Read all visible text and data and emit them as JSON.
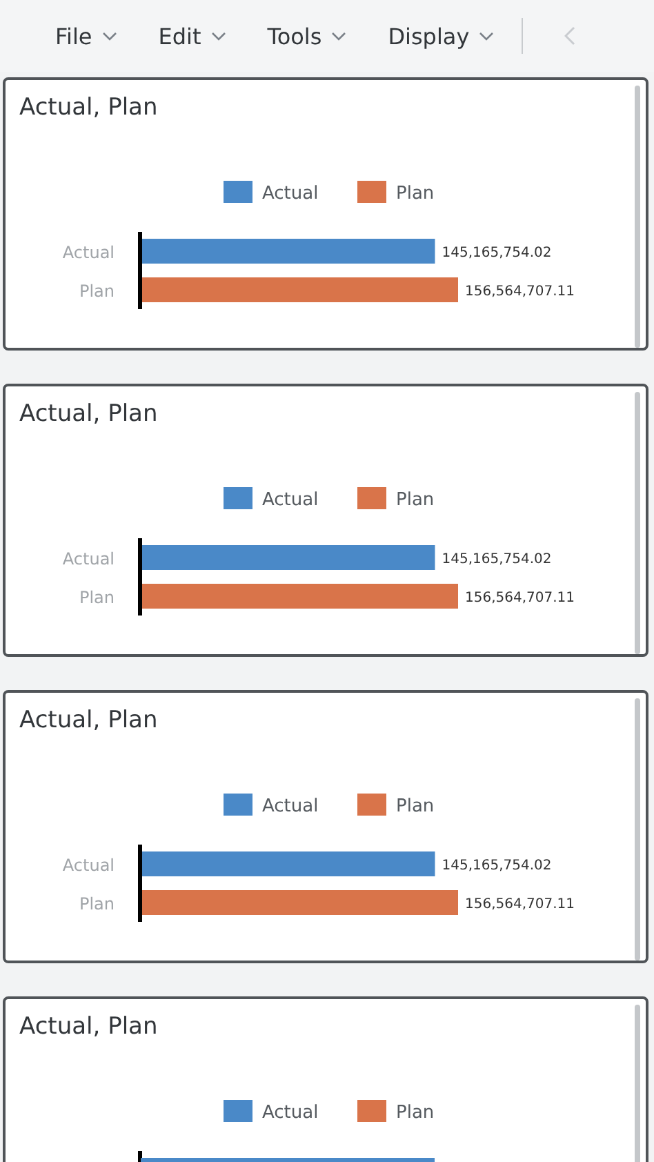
{
  "menu": [
    {
      "label": "File"
    },
    {
      "label": "Edit"
    },
    {
      "label": "Tools"
    },
    {
      "label": "Display"
    }
  ],
  "cards": [
    {
      "title": "Actual, Plan",
      "chart_data": {
        "type": "bar",
        "orientation": "horizontal",
        "legend": "top",
        "categories": [
          "Actual",
          "Plan"
        ],
        "series": [
          {
            "name": "Actual",
            "color": "#4a89c8",
            "values": [
              145165754.02,
              null
            ],
            "value_labels": [
              "145,165,754.02",
              null
            ]
          },
          {
            "name": "Plan",
            "color": "#d9744a",
            "values": [
              null,
              156564707.11
            ],
            "value_labels": [
              null,
              "156,564,707.11"
            ]
          }
        ],
        "data_labels": true
      }
    },
    {
      "title": "Actual, Plan",
      "chart_data": {
        "type": "bar",
        "orientation": "horizontal",
        "legend": "top",
        "categories": [
          "Actual",
          "Plan"
        ],
        "series": [
          {
            "name": "Actual",
            "color": "#4a89c8",
            "values": [
              145165754.02,
              null
            ],
            "value_labels": [
              "145,165,754.02",
              null
            ]
          },
          {
            "name": "Plan",
            "color": "#d9744a",
            "values": [
              null,
              156564707.11
            ],
            "value_labels": [
              null,
              "156,564,707.11"
            ]
          }
        ],
        "data_labels": true
      }
    },
    {
      "title": "Actual, Plan",
      "chart_data": {
        "type": "bar",
        "orientation": "horizontal",
        "legend": "top",
        "categories": [
          "Actual",
          "Plan"
        ],
        "series": [
          {
            "name": "Actual",
            "color": "#4a89c8",
            "values": [
              145165754.02,
              null
            ],
            "value_labels": [
              "145,165,754.02",
              null
            ]
          },
          {
            "name": "Plan",
            "color": "#d9744a",
            "values": [
              null,
              156564707.11
            ],
            "value_labels": [
              null,
              "156,564,707.11"
            ]
          }
        ],
        "data_labels": true
      }
    },
    {
      "title": "Actual, Plan",
      "legend": [
        {
          "name": "Actual",
          "color": "#4a89c8"
        },
        {
          "name": "Plan",
          "color": "#d9744a"
        }
      ]
    }
  ]
}
